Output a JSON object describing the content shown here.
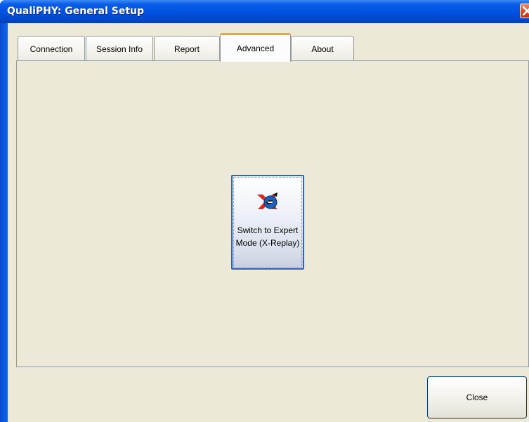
{
  "window": {
    "title": "QualiPHY: General Setup"
  },
  "tabs": [
    {
      "label": "Connection",
      "active": false
    },
    {
      "label": "Session Info",
      "active": false
    },
    {
      "label": "Report",
      "active": false
    },
    {
      "label": "Advanced",
      "active": true
    },
    {
      "label": "About",
      "active": false
    }
  ],
  "advanced": {
    "expert_button": {
      "line1": "Switch to Expert",
      "line2": "Mode (X-Replay)",
      "icon": "x-replay-icon"
    }
  },
  "footer": {
    "close_label": "Close"
  },
  "colors": {
    "titlebar": "#0053e1",
    "client_bg": "#ece9d8",
    "active_tab_accent": "#f5a623",
    "close_x": "#d8431d"
  }
}
